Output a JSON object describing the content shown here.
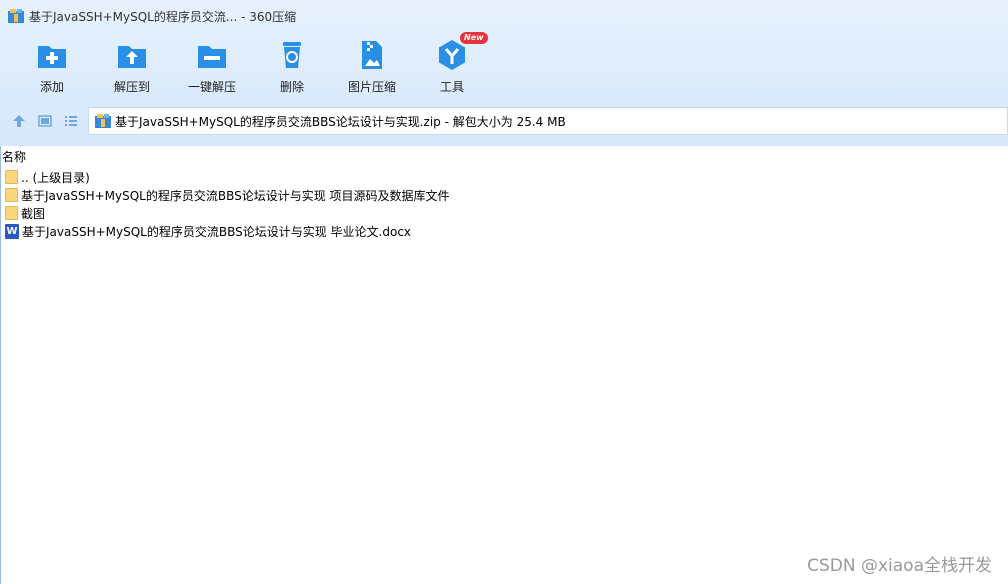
{
  "window": {
    "title": "基于JavaSSH+MySQL的程序员交流... - 360压缩"
  },
  "toolbar": {
    "items": [
      {
        "label": "添加"
      },
      {
        "label": "解压到"
      },
      {
        "label": "一键解压"
      },
      {
        "label": "删除"
      },
      {
        "label": "图片压缩"
      },
      {
        "label": "工具",
        "badge": "New"
      }
    ]
  },
  "path": {
    "text": "基于JavaSSH+MySQL的程序员交流BBS论坛设计与实现.zip - 解包大小为 25.4 MB"
  },
  "list": {
    "header": "名称",
    "rows": [
      {
        "name": ".. (上级目录)",
        "type": "folder"
      },
      {
        "name": "基于JavaSSH+MySQL的程序员交流BBS论坛设计与实现 项目源码及数据库文件",
        "type": "folder"
      },
      {
        "name": "截图",
        "type": "folder"
      },
      {
        "name": "基于JavaSSH+MySQL的程序员交流BBS论坛设计与实现 毕业论文.docx",
        "type": "word",
        "icon_letter": "W"
      }
    ]
  },
  "watermark": "CSDN @xiaoa全栈开发",
  "colors": {
    "accent": "#2a8fe6",
    "chrome": "#dcebfb",
    "badge": "#e8323e"
  }
}
